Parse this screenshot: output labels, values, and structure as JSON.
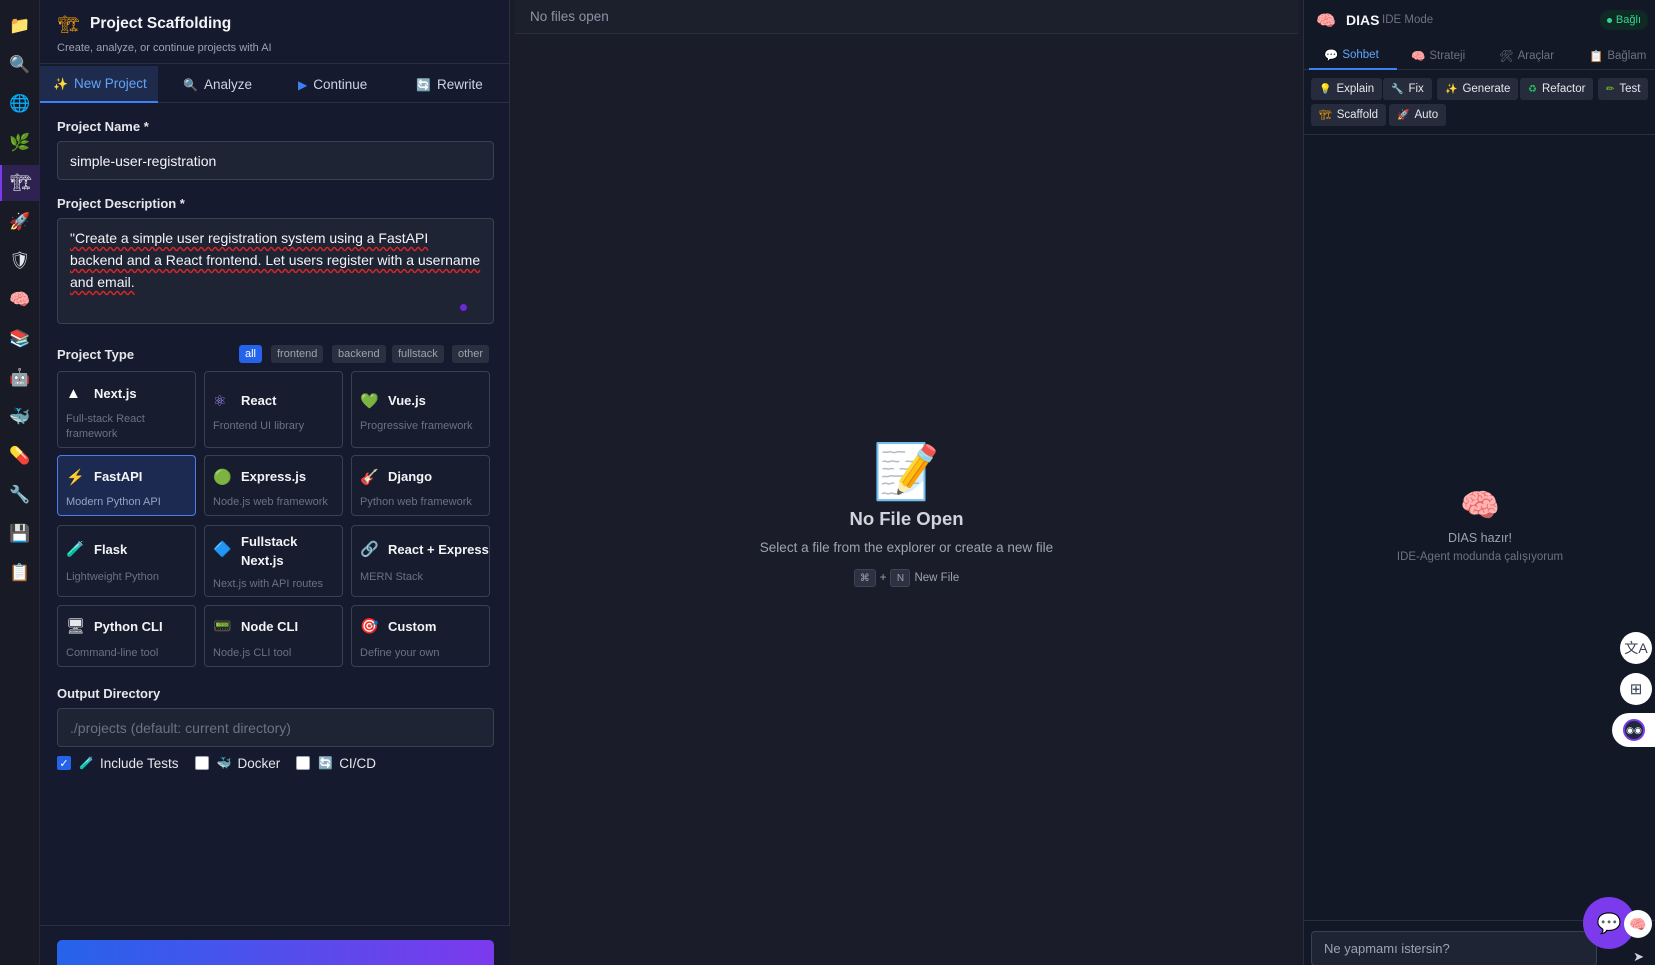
{
  "activity_bar": {
    "items": [
      {
        "name": "explorer",
        "icon": "📁"
      },
      {
        "name": "search",
        "icon": "🔍"
      },
      {
        "name": "web",
        "icon": "🌐"
      },
      {
        "name": "git",
        "icon": "🌿"
      },
      {
        "name": "scaffold",
        "icon": "🏗"
      },
      {
        "name": "deploy",
        "icon": "🚀"
      },
      {
        "name": "security",
        "icon": "🛡"
      },
      {
        "name": "ai",
        "icon": "🧠"
      },
      {
        "name": "library",
        "icon": "📚"
      },
      {
        "name": "robot",
        "icon": "🤖"
      },
      {
        "name": "docker",
        "icon": "🐳"
      },
      {
        "name": "test",
        "icon": "💊"
      },
      {
        "name": "tools",
        "icon": "🔧"
      },
      {
        "name": "save",
        "icon": "💾"
      },
      {
        "name": "notes",
        "icon": "📋"
      }
    ],
    "active_item": "scaffold"
  },
  "scaffold": {
    "icon": "🏗",
    "title": "Project Scaffolding",
    "subtitle": "Create, analyze, or continue projects with AI",
    "tabs": [
      {
        "icon": "✨",
        "label": "New Project",
        "active": true
      },
      {
        "icon": "🔍",
        "label": "Analyze",
        "active": false
      },
      {
        "icon": "▶",
        "label": "Continue",
        "active": false
      },
      {
        "icon": "🔄",
        "label": "Rewrite",
        "active": false
      }
    ],
    "name_label": "Project Name *",
    "name_value": "simple-user-registration",
    "desc_label": "Project Description *",
    "desc_value": "\"Create a simple user registration system using a FastAPI backend and a React frontend. Let users register with a username and email.",
    "type_label": "Project Type",
    "filters": [
      "all",
      "frontend",
      "backend",
      "fullstack",
      "other"
    ],
    "active_filter": "all",
    "types": [
      {
        "icon": "▲",
        "title": "Next.js",
        "desc": "Full-stack React framework",
        "selected": false
      },
      {
        "icon": "⚛",
        "title": "React",
        "desc": "Frontend UI library",
        "selected": false
      },
      {
        "icon": "💚",
        "title": "Vue.js",
        "desc": "Progressive framework",
        "selected": false
      },
      {
        "icon": "⚡",
        "title": "FastAPI",
        "desc": "Modern Python API",
        "selected": true
      },
      {
        "icon": "🟢",
        "title": "Express.js",
        "desc": "Node.js web framework",
        "selected": false
      },
      {
        "icon": "🎸",
        "title": "Django",
        "desc": "Python web framework",
        "selected": false
      },
      {
        "icon": "🧪",
        "title": "Flask",
        "desc": "Lightweight Python",
        "selected": false
      },
      {
        "icon": "🔷",
        "title": "Fullstack Next.js",
        "desc": "Next.js with API routes",
        "selected": false
      },
      {
        "icon": "🔗",
        "title": "React + Express",
        "desc": "MERN Stack",
        "selected": false
      },
      {
        "icon": "🖥",
        "title": "Python CLI",
        "desc": "Command-line tool",
        "selected": false
      },
      {
        "icon": "📟",
        "title": "Node CLI",
        "desc": "Node.js CLI tool",
        "selected": false
      },
      {
        "icon": "🎯",
        "title": "Custom",
        "desc": "Define your own",
        "selected": false
      }
    ],
    "output_label": "Output Directory",
    "output_placeholder": "./projects (default: current directory)",
    "options": [
      {
        "icon": "🧪",
        "label": "Include Tests",
        "checked": true
      },
      {
        "icon": "🐳",
        "label": "Docker",
        "checked": false
      },
      {
        "icon": "🔄",
        "label": "CI/CD",
        "checked": false
      }
    ]
  },
  "editor": {
    "tab_text": "No files open",
    "empty_icon": "📝",
    "empty_title": "No File Open",
    "empty_subtitle": "Select a file from the explorer or create a new file",
    "shortcut_mod": "⌘",
    "shortcut_plus": "+",
    "shortcut_key": "N",
    "shortcut_label": "New File"
  },
  "dias": {
    "icon": "🧠",
    "title": "DIAS",
    "mode": "IDE Mode",
    "status": "Bağlı",
    "tabs": [
      {
        "icon": "💬",
        "label": "Sohbet",
        "active": true
      },
      {
        "icon": "🧠",
        "label": "Strateji",
        "active": false
      },
      {
        "icon": "🛠",
        "label": "Araçlar",
        "active": false
      },
      {
        "icon": "📋",
        "label": "Bağlam",
        "active": false
      }
    ],
    "quick_actions": [
      {
        "icon": "💡",
        "label": "Explain"
      },
      {
        "icon": "🔧",
        "label": "Fix"
      },
      {
        "icon": "✨",
        "label": "Generate"
      },
      {
        "icon": "♻",
        "label": "Refactor"
      },
      {
        "icon": "✏",
        "label": "Test"
      },
      {
        "icon": "🏗",
        "label": "Scaffold"
      },
      {
        "icon": "🚀",
        "label": "Auto"
      }
    ],
    "empty_icon": "🧠",
    "ready_text": "DIAS hazır!",
    "mode_text": "IDE-Agent modunda çalışıyorum",
    "input_placeholder": "Ne yapmamı istersin?",
    "send_icon": "➤"
  },
  "floating": {
    "translate_icon": "文A",
    "apps_icon": "⊞",
    "bot_icon": "◉◉",
    "chat_icon": "💬",
    "brain_icon": "🧠"
  }
}
